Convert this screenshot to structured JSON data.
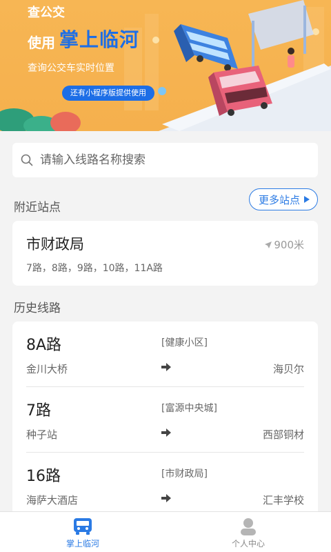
{
  "banner": {
    "line1": "查公交",
    "line2_prefix": "使用",
    "line2_brand": "掌上临河",
    "subtitle": "查询公交车实时位置",
    "pill": "还有小程序版提供使用"
  },
  "search": {
    "placeholder": "请输入线路名称搜索"
  },
  "nearby": {
    "title": "附近站点",
    "more_label": "更多站点",
    "stop": {
      "name": "市财政局",
      "distance": "900米",
      "lines": "7路，8路，9路，10路，11A路"
    }
  },
  "history": {
    "title": "历史线路",
    "routes": [
      {
        "name": "8A路",
        "direction": "[健康小区]",
        "from": "金川大桥",
        "to": "海贝尔"
      },
      {
        "name": "7路",
        "direction": "[富源中央城]",
        "from": "种子站",
        "to": "西部铜材"
      },
      {
        "name": "16路",
        "direction": "[市财政局]",
        "from": "海萨大酒店",
        "to": "汇丰学校"
      }
    ]
  },
  "tabbar": {
    "tabs": [
      {
        "label": "掌上临河",
        "icon": "bus-icon",
        "active": true
      },
      {
        "label": "个人中心",
        "icon": "user-icon",
        "active": false
      }
    ]
  },
  "colors": {
    "accent": "#2a7ae4",
    "banner": "#f5b04d",
    "background": "#f3f3f3"
  }
}
